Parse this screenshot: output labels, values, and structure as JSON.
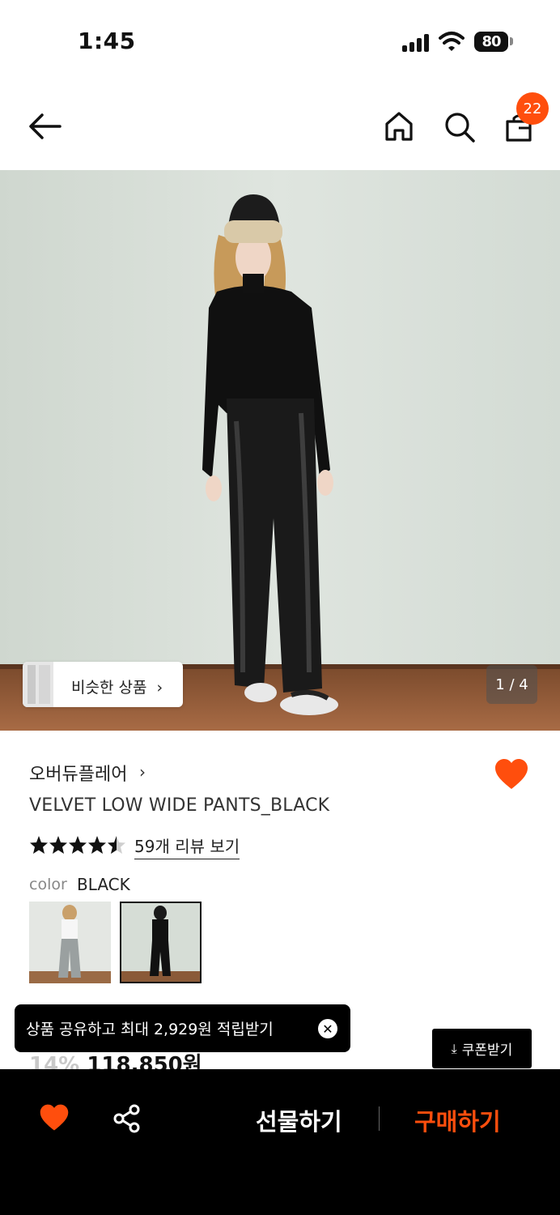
{
  "status_bar": {
    "time": "1:45",
    "battery": "80"
  },
  "header": {
    "back_icon": "arrow-left-icon",
    "home_icon": "home-icon",
    "search_icon": "search-icon",
    "cart_icon": "shopping-bag-icon",
    "cart_count": "22"
  },
  "hero": {
    "similar_products_label": "비슷한 상품",
    "page_indicator": "1 / 4"
  },
  "product": {
    "brand": "오버듀플레어",
    "name": "VELVET LOW WIDE PANTS_BLACK",
    "rating": 4.5,
    "review_link": "59개 리뷰 보기",
    "color_label": "color",
    "color_value": "BLACK",
    "discount": "14%",
    "price": "118,850원"
  },
  "toast": {
    "text": "상품 공유하고 최대 2,929원 적립받기"
  },
  "coupon_button": "쿠폰받기",
  "bottom_bar": {
    "gift_label": "선물하기",
    "buy_label": "구매하기"
  },
  "colors": {
    "accent": "#ff4e0d",
    "background": "#ffffff",
    "bar": "#000000"
  }
}
